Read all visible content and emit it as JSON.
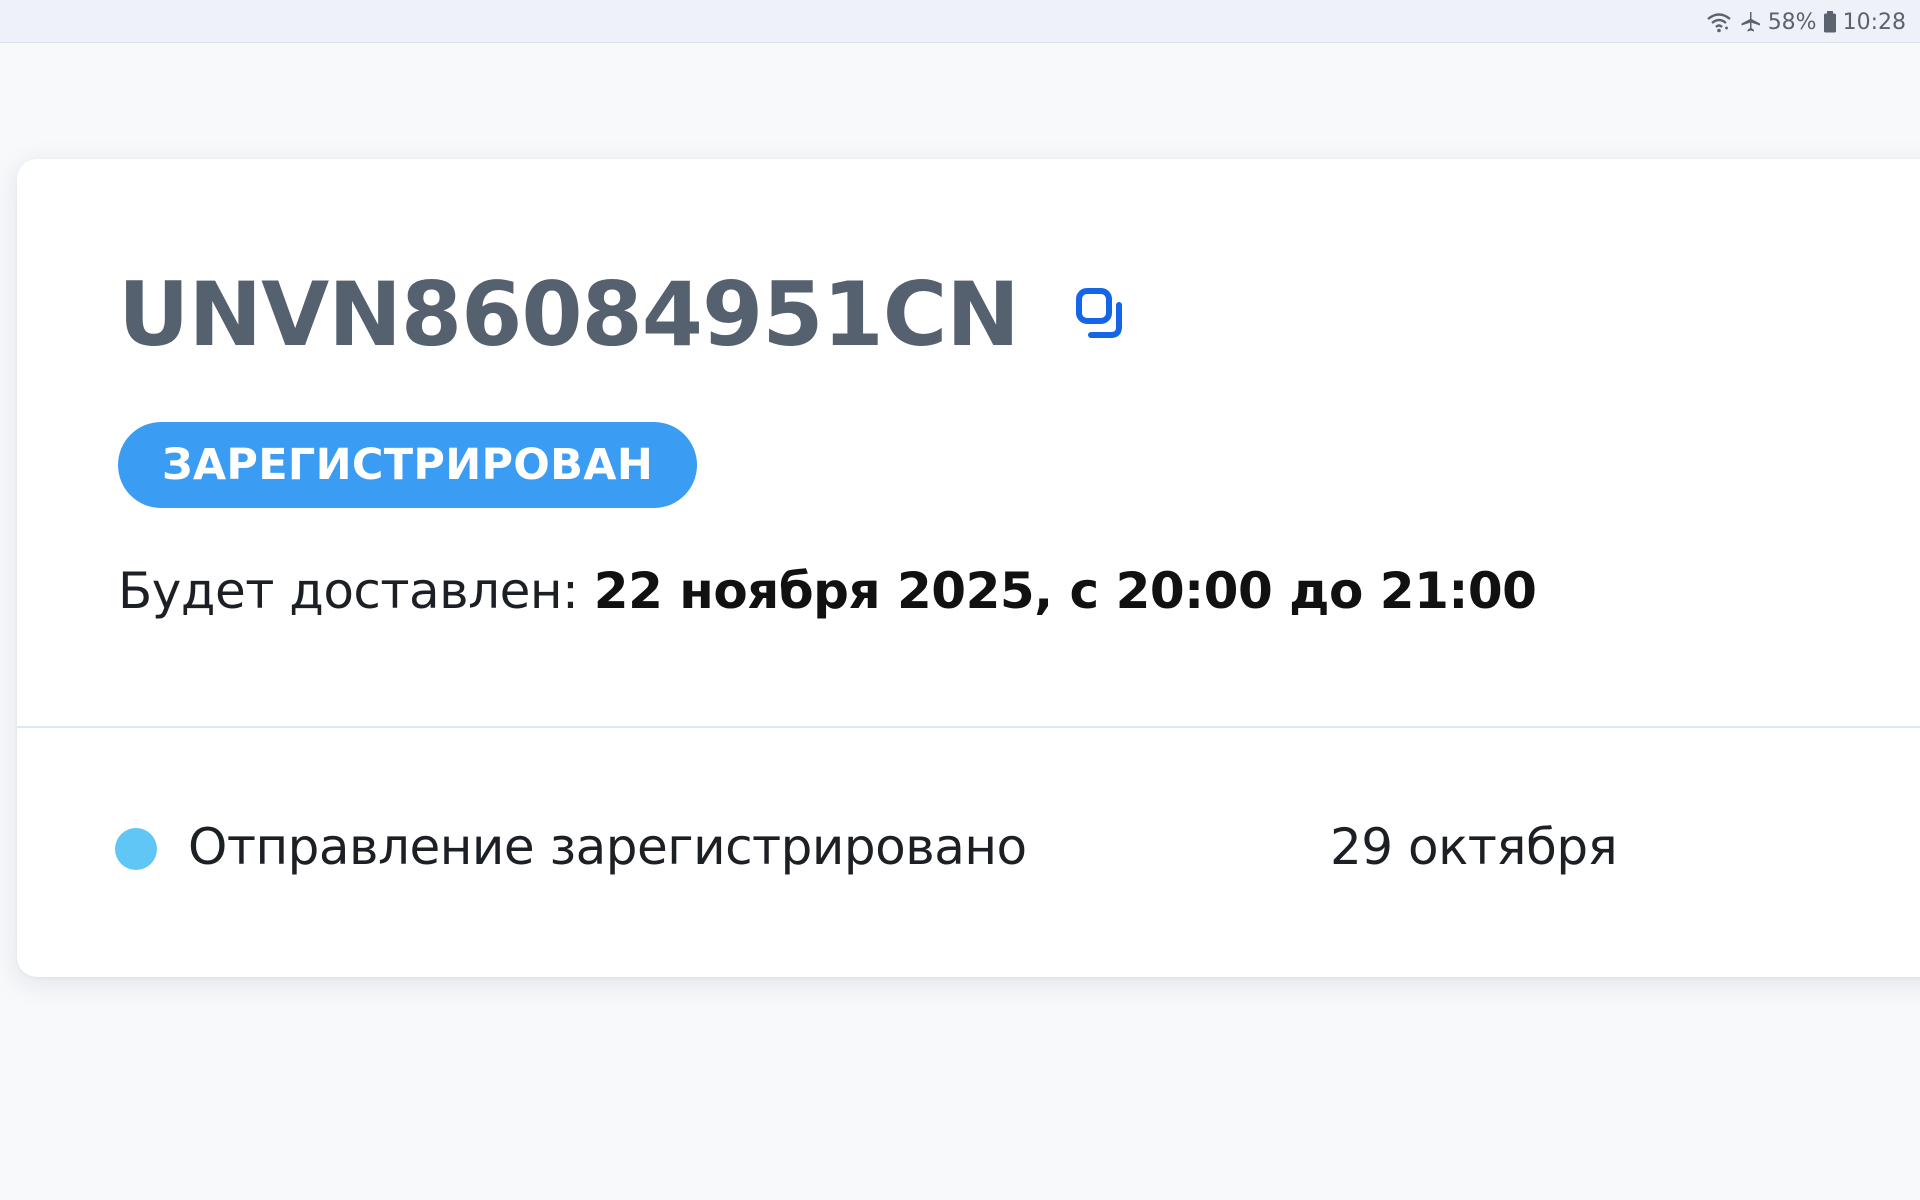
{
  "status_bar": {
    "battery_percent": "58%",
    "time": "10:28",
    "icons": [
      "wifi-icon",
      "airplane-mode-icon",
      "battery-icon"
    ]
  },
  "shipment": {
    "tracking_number": "UNVN86084951CN",
    "copy_icon": "copy-icon",
    "status_label": "ЗАРЕГИСТРИРОВАН",
    "delivery_label": "Будет доставлен: ",
    "delivery_value": "22 ноября 2025, с 20:00 до 21:00"
  },
  "events": [
    {
      "text": "Отправление зарегистрировано",
      "date": "29 октября",
      "dot_color": "#5fc6f5"
    }
  ],
  "colors": {
    "accent": "#3a9cf2",
    "copy_icon": "#1565e8",
    "tracking_text": "#566170",
    "event_dot": "#5fc6f5"
  }
}
